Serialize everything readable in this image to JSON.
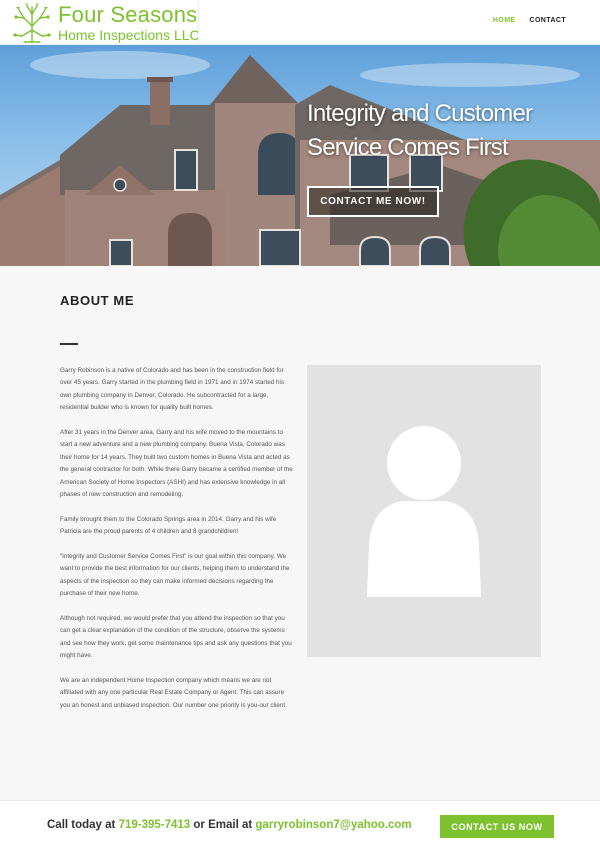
{
  "brand": {
    "name": "Four Seasons",
    "subtitle": "Home Inspections LLC",
    "accent_color": "#7dc12f"
  },
  "nav": {
    "items": [
      {
        "label": "HOME",
        "active": true
      },
      {
        "label": "CONTACT",
        "active": false
      }
    ]
  },
  "hero": {
    "title_line1": "Integrity and Customer",
    "title_line2": "Service Comes First",
    "cta_label": "CONTACT ME NOW!"
  },
  "about": {
    "heading": "ABOUT ME",
    "paragraphs": [
      "Garry Robinson is a native of Colorado and has been in the construction field for over 45 years. Garry started in the plumbing field in 1971 and in 1974 started his own plumbing company in Denver, Colorado. He subcontracted for a large, residential builder who is known for quality built homes.",
      "After 31 years in the Denver area, Garry and his wife moved to the mountains to start a new adventure and a new plumbing company. Buena Vista, Colorado was their home for 14 years. They built two custom homes in Buena Vista and acted as the general contractor for both. While there Garry became a certified member of the American Society of Home Inspectors (ASHI) and has extensive knowledge in all phases of new construction and remodeling.",
      "Family brought them to the Colorado Springs area in 2014. Garry and his wife Patricia are the proud parents of 4 children and 8 grandchildren!",
      "“Integrity and Customer Service Comes First” is our goal within this company. We want to provide the best information for our clients, helping them to understand the aspects of the inspection so they can make informed decisions regarding the purchase of their new home.",
      "Although not required, we would prefer that you attend the inspection so that you can get a clear explanation of the condition of the structure, observe the systems and see how they work, get some maintenance tips and ask any questions that you might have.",
      "We are an independent Home Inspection company which means we are not affiliated with any one particular Real Estate Company or Agent. This can assure you an honest and unbiased inspection. Our number one priority is you-our client."
    ]
  },
  "footer": {
    "call_prefix": "Call today at ",
    "phone": "719-395-7413",
    "email_prefix": " or Email at ",
    "email": "garryrobinson7@yahoo.com",
    "cta_label": "CONTACT US NOW"
  },
  "icons": {
    "logo": "tree-seasons-icon",
    "avatar": "person-placeholder-icon"
  }
}
